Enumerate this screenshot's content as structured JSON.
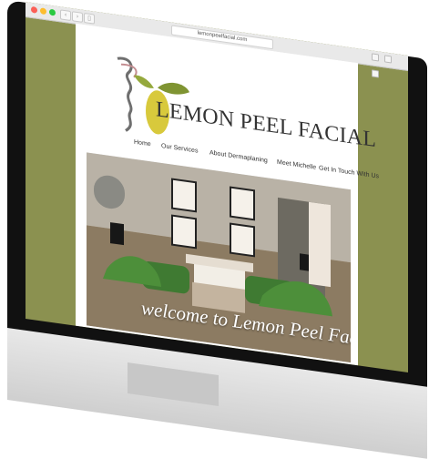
{
  "browser": {
    "url": "lemonpeelfacial.com",
    "controls": {
      "back_icon": "chevron-left-icon",
      "forward_icon": "chevron-right-icon",
      "sidebar_icon": "sidebar-icon"
    },
    "toolbar_icons": [
      "reload-icon",
      "share-icon",
      "tabs-icon"
    ]
  },
  "site": {
    "title": "LEMON PEEL FACIAL",
    "nav": [
      "Home",
      "Our Services",
      "About Dermaplaning",
      "Meet Michelle",
      "Get In Touch With Us"
    ],
    "hero_caption": "welcome to Lemon Peel Facial",
    "colors": {
      "frame": "#8b9150",
      "header_divider": "#8b9150",
      "lemon": "#d8c93c"
    }
  }
}
